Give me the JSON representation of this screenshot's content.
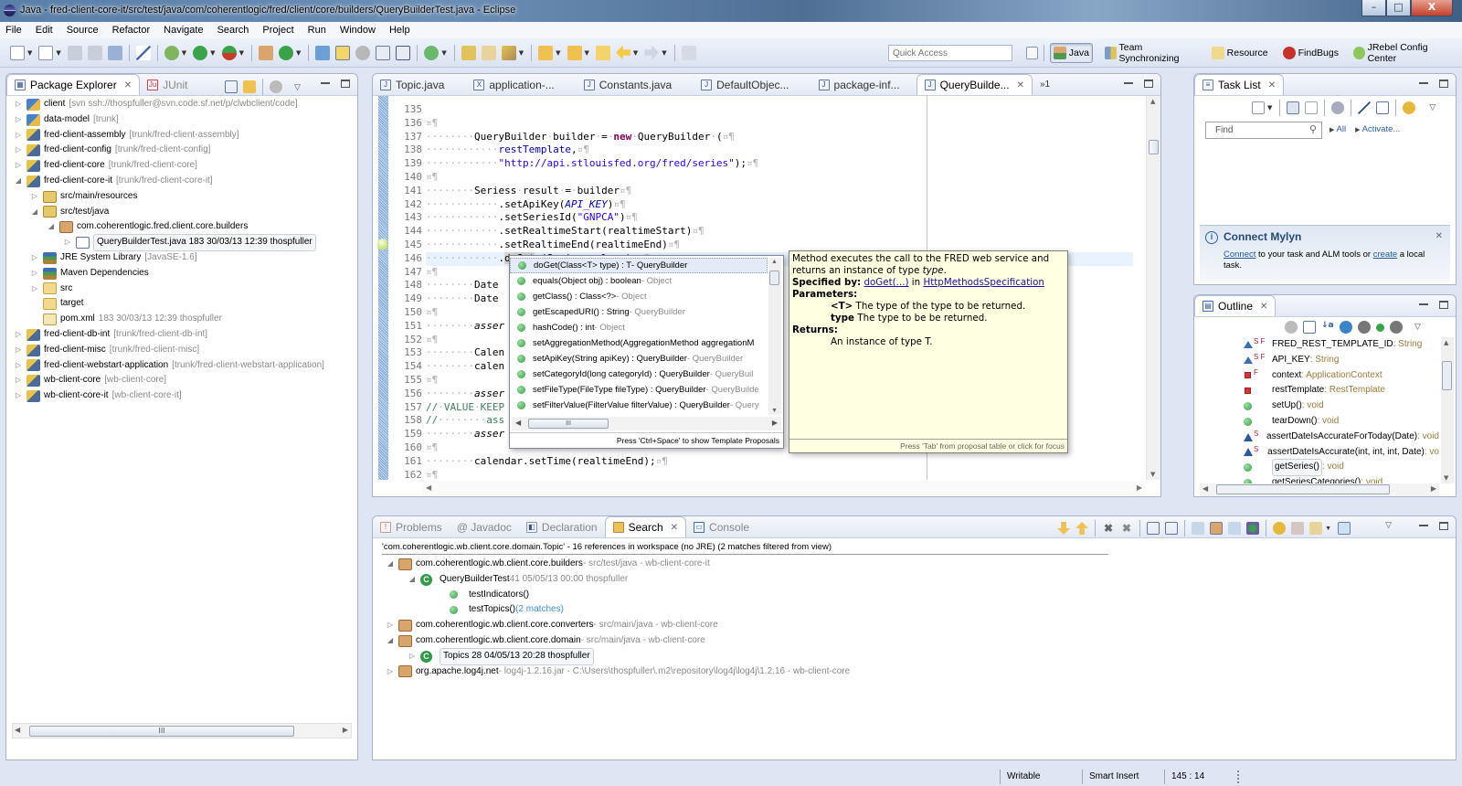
{
  "window": {
    "title": "Java - fred-client-core-it/src/test/java/com/coherentlogic/fred/client/core/builders/QueryBuilderTest.java - Eclipse",
    "controls": {
      "minimize": "–",
      "maximize": "□",
      "close": "X"
    }
  },
  "menu": [
    "File",
    "Edit",
    "Source",
    "Refactor",
    "Navigate",
    "Search",
    "Project",
    "Run",
    "Window",
    "Help"
  ],
  "toolbar": {
    "quick_access_placeholder": "Quick Access",
    "icons": [
      "new-icon",
      "new-type-icon",
      "save-icon",
      "save-all-icon",
      "print-icon",
      "skip-breakpoints-icon",
      "debug-icon",
      "run-icon",
      "run-external-tools-icon",
      "new-package-icon",
      "new-class-icon",
      "open-type-icon",
      "mark-occurrences-icon",
      "toggle-block-selection-icon",
      "show-whitespace-icon",
      "show-source-icon",
      "toggle-paragraph-icon",
      "jrebel-icon",
      "open-task-icon",
      "search-icon",
      "next-annotation-icon",
      "previous-annotation-icon",
      "last-edit-icon",
      "back-icon",
      "forward-icon",
      "pin-editor-icon"
    ]
  },
  "perspectives": {
    "open_perspective_icon": "open-perspective-icon",
    "items": [
      {
        "label": "Java",
        "active": true,
        "icon": "java-perspective-icon"
      },
      {
        "label": "Team Synchronizing",
        "active": false,
        "icon": "team-sync-icon"
      },
      {
        "label": "Resource",
        "active": false,
        "icon": "resource-icon"
      },
      {
        "label": "FindBugs",
        "active": false,
        "icon": "findbugs-icon"
      },
      {
        "label": "JRebel Config Center",
        "active": false,
        "icon": "jrebel-icon"
      }
    ]
  },
  "package_explorer": {
    "tabs": [
      {
        "label": "Package Explorer",
        "active": true
      },
      {
        "label": "JUnit",
        "active": false
      }
    ],
    "tree": [
      {
        "indent": 0,
        "toggle": "collapsed",
        "icon": "project",
        "name": "client",
        "decoration": "[svn ssh://thospfuller@svn.code.sf.net/p/clwbclient/code]"
      },
      {
        "indent": 0,
        "toggle": "collapsed",
        "icon": "project",
        "name": "data-model",
        "decoration": "[trunk]"
      },
      {
        "indent": 0,
        "toggle": "collapsed",
        "icon": "project-warning",
        "name": "fred-client-assembly",
        "decoration": "[trunk/fred-client-assembly]"
      },
      {
        "indent": 0,
        "toggle": "collapsed",
        "icon": "project-warning",
        "name": "fred-client-config",
        "decoration": "[trunk/fred-client-config]"
      },
      {
        "indent": 0,
        "toggle": "collapsed",
        "icon": "project-warning",
        "name": "fred-client-core",
        "decoration": "[trunk/fred-client-core]"
      },
      {
        "indent": 0,
        "toggle": "expanded",
        "icon": "project-warning",
        "name": "fred-client-core-it",
        "decoration": "[trunk/fred-client-core-it]"
      },
      {
        "indent": 1,
        "toggle": "collapsed",
        "icon": "source-folder",
        "name": "src/main/resources",
        "decoration": ""
      },
      {
        "indent": 1,
        "toggle": "expanded",
        "icon": "source-folder",
        "name": "src/test/java",
        "decoration": ""
      },
      {
        "indent": 2,
        "toggle": "expanded",
        "icon": "package",
        "name": "com.coherentlogic.fred.client.core.builders",
        "decoration": ""
      },
      {
        "indent": 3,
        "toggle": "collapsed",
        "icon": "java-file",
        "name": "QueryBuilderTest.java 183  30/03/13 12:39  thospfuller",
        "decoration": "",
        "selected": true
      },
      {
        "indent": 1,
        "toggle": "collapsed",
        "icon": "library",
        "name": "JRE System Library",
        "decoration": "[JavaSE-1.6]"
      },
      {
        "indent": 1,
        "toggle": "collapsed",
        "icon": "library",
        "name": "Maven Dependencies",
        "decoration": ""
      },
      {
        "indent": 1,
        "toggle": "collapsed",
        "icon": "folder",
        "name": "src",
        "decoration": ""
      },
      {
        "indent": 1,
        "toggle": "none",
        "icon": "folder",
        "name": "target",
        "decoration": ""
      },
      {
        "indent": 1,
        "toggle": "none",
        "icon": "xml-file",
        "name": "pom.xml",
        "decoration": "183  30/03/13 12:39  thospfuller"
      },
      {
        "indent": 0,
        "toggle": "collapsed",
        "icon": "project-warning",
        "name": "fred-client-db-int",
        "decoration": "[trunk/fred-client-db-int]"
      },
      {
        "indent": 0,
        "toggle": "collapsed",
        "icon": "project-warning",
        "name": "fred-client-misc",
        "decoration": "[trunk/fred-client-misc]"
      },
      {
        "indent": 0,
        "toggle": "collapsed",
        "icon": "project-warning",
        "name": "fred-client-webstart-application",
        "decoration": "[trunk/fred-client-webstart-application]"
      },
      {
        "indent": 0,
        "toggle": "collapsed",
        "icon": "project-warning",
        "name": "wb-client-core",
        "decoration": "[wb-client-core]"
      },
      {
        "indent": 0,
        "toggle": "collapsed",
        "icon": "project-warning",
        "name": "wb-client-core-it",
        "decoration": "[wb-client-core-it]"
      }
    ],
    "hscroll_thumb_label": "III"
  },
  "editor": {
    "tabs": [
      {
        "label": "Topic.java",
        "icon": "J",
        "active": false
      },
      {
        "label": "application-...",
        "icon": "X",
        "active": false
      },
      {
        "label": "Constants.java",
        "icon": "J",
        "active": false
      },
      {
        "label": "DefaultObjec...",
        "icon": "J",
        "active": false
      },
      {
        "label": "package-inf...",
        "icon": "J",
        "active": false
      },
      {
        "label": "QueryBuilde...",
        "icon": "J",
        "active": true
      }
    ],
    "overflow_label": "»1",
    "line_numbers": [
      "135",
      "136",
      "137",
      "138",
      "139",
      "140",
      "141",
      "142",
      "143",
      "144",
      "145",
      "146",
      "147",
      "148",
      "149",
      "150",
      "151",
      "152",
      "153",
      "154",
      "155",
      "156",
      "157",
      "158",
      "159",
      "160",
      "161",
      "162"
    ],
    "current_line": "145"
  },
  "content_assist": {
    "proposals": [
      {
        "sig": "doGet(Class<T> type) : T",
        "owner": "QueryBuilder",
        "owner_dim": false,
        "selected": true
      },
      {
        "sig": "equals(Object obj) : boolean",
        "owner": "Object",
        "owner_dim": true
      },
      {
        "sig": "getClass() : Class<?>",
        "owner": "Object",
        "owner_dim": true
      },
      {
        "sig": "getEscapedURI() : String",
        "owner": "QueryBuilder",
        "owner_dim": true
      },
      {
        "sig": "hashCode() : int",
        "owner": "Object",
        "owner_dim": true
      },
      {
        "sig": "setAggregationMethod(AggregationMethod aggregationM",
        "owner": "",
        "owner_dim": true
      },
      {
        "sig": "setApiKey(String apiKey) : QueryBuilder",
        "owner": "QueryBuilder",
        "owner_dim": true
      },
      {
        "sig": "setCategoryId(long categoryId) : QueryBuilder",
        "owner": "QueryBuil",
        "owner_dim": true
      },
      {
        "sig": "setFileType(FileType fileType) : QueryBuilder",
        "owner": "QueryBuilde",
        "owner_dim": true
      },
      {
        "sig": "setFilterValue(FilterValue filterValue) : QueryBuilder",
        "owner": "Query",
        "owner_dim": true
      }
    ],
    "footer": "Press 'Ctrl+Space' to show Template Proposals",
    "hscroll_thumb_label": "III"
  },
  "javadoc_popup": {
    "summary_a": "Method executes the call to the FRED web service and returns an instance of type ",
    "summary_type": "type",
    "summary_end": ".",
    "specified_by_label": "Specified by:",
    "specified_by_method": "doGet(...)",
    "specified_in": "in",
    "specified_by_class": "HttpMethodsSpecification",
    "parameters_label": "Parameters:",
    "param1_name": "<T>",
    "param1_desc": " The type of the type to be returned.",
    "param2_name": "type",
    "param2_desc": " The type to be be returned.",
    "returns_label": "Returns:",
    "returns_desc": "An instance of type T.",
    "footer": "Press 'Tab' from proposal table or click for focus"
  },
  "task_list": {
    "tab_label": "Task List",
    "find_placeholder": "Find",
    "all_label": "All",
    "activate_label": "Activate...",
    "mylyn": {
      "title": "Connect Mylyn",
      "connect_link": "Connect",
      "text_mid": " to your task and ALM tools or ",
      "create_link": "create",
      "text_end": " a local task."
    }
  },
  "outline": {
    "tab_label": "Outline",
    "items": [
      {
        "icon": "static-final-field",
        "badge": "S F",
        "name": "FRED_REST_TEMPLATE_ID",
        "type": " : String"
      },
      {
        "icon": "static-final-field",
        "badge": "S F",
        "name": "API_KEY",
        "type": " : String"
      },
      {
        "icon": "private-field",
        "badge": "F",
        "name": "context",
        "type": " : ApplicationContext"
      },
      {
        "icon": "private-field",
        "badge": "",
        "name": "restTemplate",
        "type": " : RestTemplate"
      },
      {
        "icon": "public-method",
        "badge": "",
        "name": "setUp()",
        "type": " : void"
      },
      {
        "icon": "public-method",
        "badge": "",
        "name": "tearDown()",
        "type": " : void"
      },
      {
        "icon": "default-method",
        "badge": "S",
        "name": "assertDateIsAccurateForToday(Date)",
        "type": " : void"
      },
      {
        "icon": "default-method",
        "badge": "S",
        "name": "assertDateIsAccurate(int, int, int, Date)",
        "type": " : vo"
      },
      {
        "icon": "public-method",
        "badge": "",
        "name": "getSeries()",
        "type": " : void",
        "selected": true
      },
      {
        "icon": "public-method",
        "badge": "",
        "name": "getSeriesCategories()",
        "type": " : void"
      }
    ]
  },
  "bottom_panel": {
    "tabs": [
      {
        "label": "Problems",
        "active": false
      },
      {
        "label": "@ Javadoc",
        "active": false
      },
      {
        "label": "Declaration",
        "active": false
      },
      {
        "label": "Search",
        "active": true
      },
      {
        "label": "Console",
        "active": false
      }
    ],
    "search_summary": "'com.coherentlogic.wb.client.core.domain.Topic' - 16 references in workspace (no JRE) (2 matches filtered from view)",
    "results": [
      {
        "indent": 0,
        "toggle": "expanded",
        "icon": "package",
        "name": "com.coherentlogic.wb.client.core.builders",
        "detail": " - src/test/java - wb-client-core-it"
      },
      {
        "indent": 1,
        "toggle": "expanded",
        "icon": "class",
        "name": "QueryBuilderTest",
        "detail": " 41  05/05/13 00:00  thospfuller"
      },
      {
        "indent": 2,
        "toggle": "none",
        "icon": "method",
        "name": "testIndicators()",
        "detail": ""
      },
      {
        "indent": 2,
        "toggle": "none",
        "icon": "method",
        "name": "testTopics()",
        "detail": " (2 matches)",
        "detail_blue": true
      },
      {
        "indent": 0,
        "toggle": "collapsed",
        "icon": "package-warning",
        "name": "com.coherentlogic.wb.client.core.converters",
        "detail": " - src/main/java - wb-client-core"
      },
      {
        "indent": 0,
        "toggle": "expanded",
        "icon": "package",
        "name": "com.coherentlogic.wb.client.core.domain",
        "detail": " - src/main/java - wb-client-core"
      },
      {
        "indent": 1,
        "toggle": "collapsed",
        "icon": "class",
        "name": "Topics 28  04/05/13 20:28  thospfuller",
        "detail": "",
        "selected": true
      },
      {
        "indent": 0,
        "toggle": "collapsed",
        "icon": "package-jar",
        "name": "org.apache.log4j.net",
        "detail": " - log4j-1.2.16.jar - C:\\Users\\thospfuller\\.m2\\repository\\log4j\\log4j\\1.2.16 - wb-client-core"
      }
    ]
  },
  "status_bar": {
    "mode": "Writable",
    "insert": "Smart Insert",
    "position": "145 : 14"
  }
}
